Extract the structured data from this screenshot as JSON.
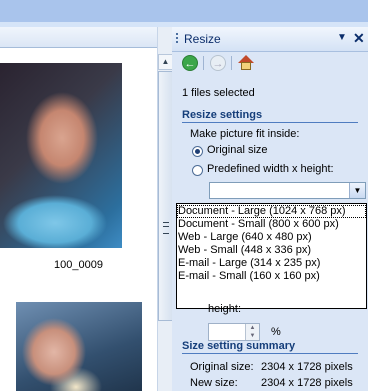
{
  "left_pane": {
    "thumbnail_caption": "100_0009"
  },
  "task_pane": {
    "title": "Resize",
    "dropdown_glyph": "▼",
    "close_glyph": "✕",
    "nav": {
      "back_icon": "back-arrow-icon",
      "forward_icon": "forward-arrow-icon",
      "home_icon": "home-icon"
    },
    "files_selected": "1 files selected",
    "resize_settings": {
      "heading": "Resize settings",
      "fit_label": "Make picture fit inside:",
      "options": [
        {
          "label": "Original size",
          "selected": true
        },
        {
          "label": "Predefined width x height:",
          "selected": false
        }
      ],
      "predefined_value": "",
      "predefined_options": [
        "Document - Large (1024 x 768 px)",
        "Document - Small (800 x 600 px)",
        "Web - Large (640 x 480 px)",
        "Web - Small (448 x 336 px)",
        "E-mail - Large (314 x 235 px)",
        "E-mail - Small (160 x 160 px)"
      ],
      "height_label": "height:",
      "percent_value": "",
      "percent_unit": "%"
    },
    "summary": {
      "heading": "Size setting summary",
      "original_label": "Original size:",
      "original_value": "2304 x 1728 pixels",
      "new_label": "New size:",
      "new_value": "2304 x 1728 pixels"
    }
  }
}
